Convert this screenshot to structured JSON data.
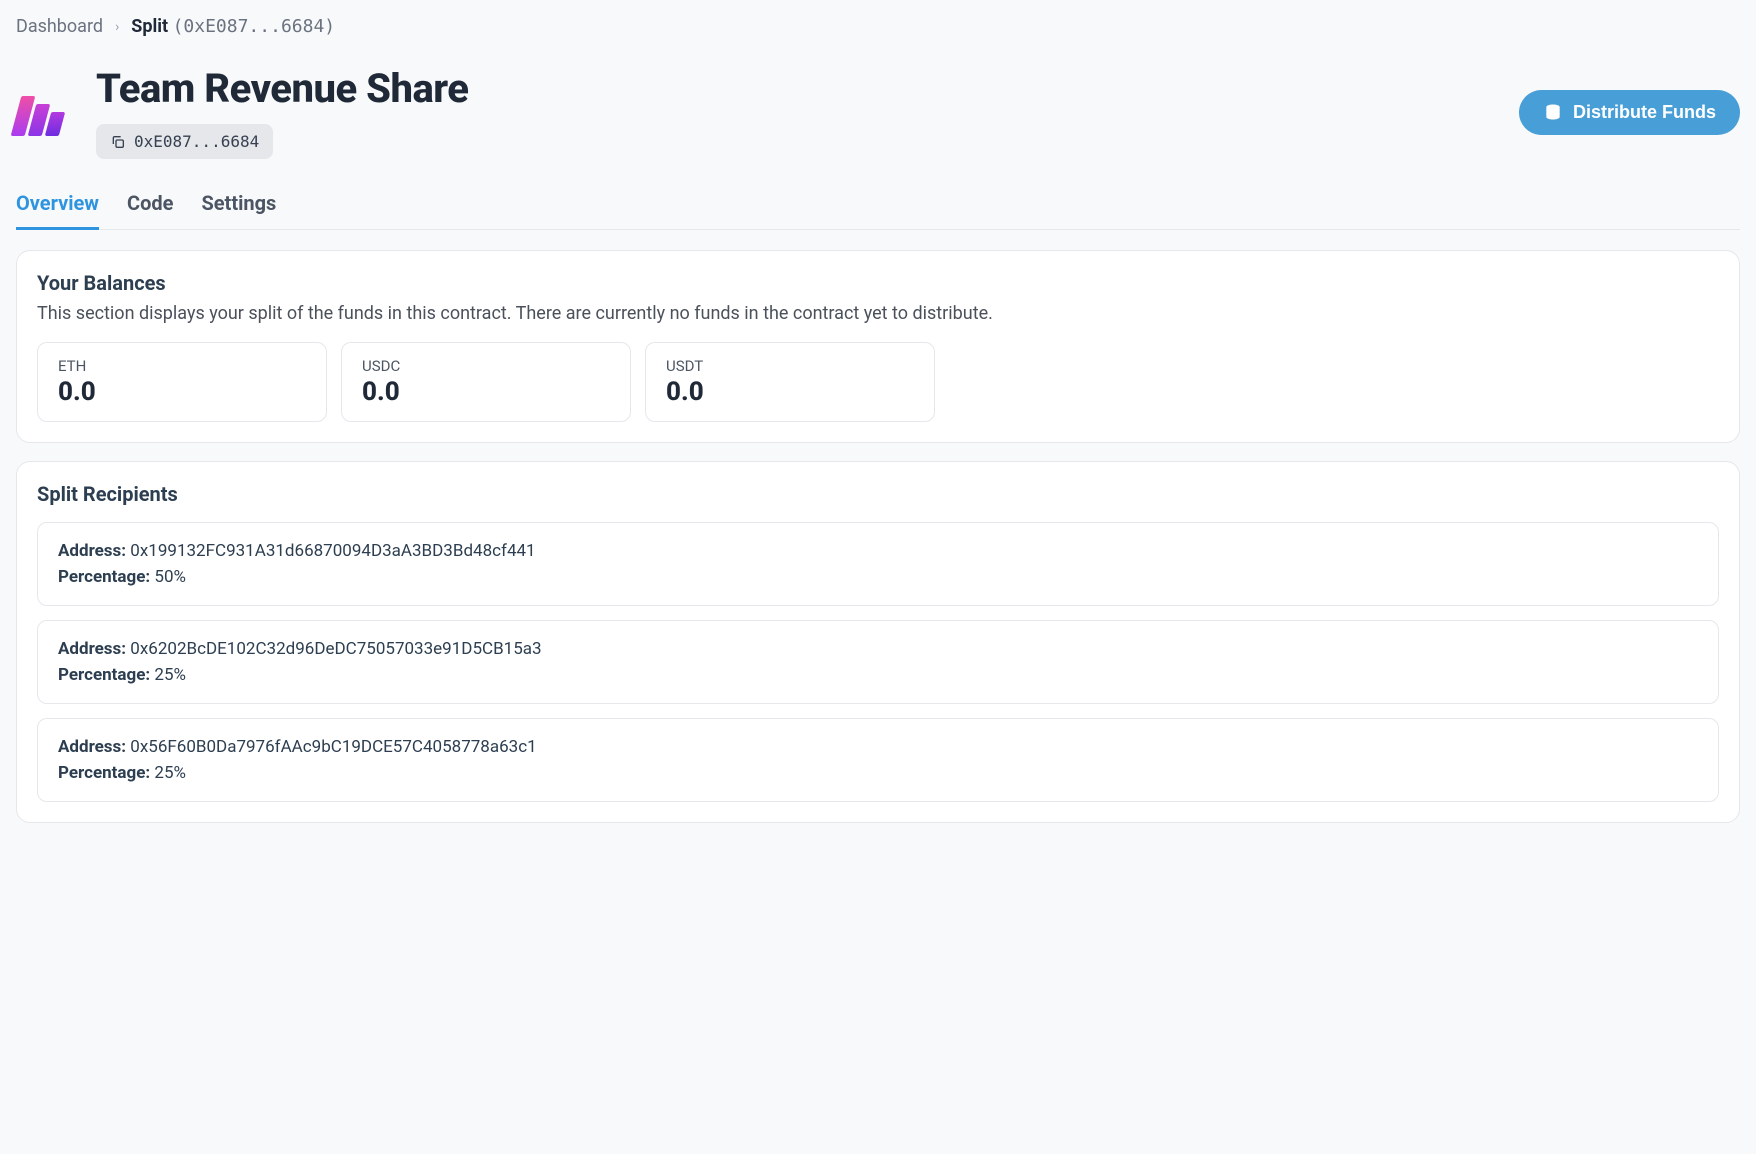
{
  "breadcrumb": {
    "root": "Dashboard",
    "current": "Split",
    "current_hash": "(0xE087...6684)"
  },
  "header": {
    "title": "Team Revenue Share",
    "address_chip": "0xE087...6684",
    "distribute_label": "Distribute Funds"
  },
  "tabs": [
    {
      "label": "Overview",
      "active": true
    },
    {
      "label": "Code",
      "active": false
    },
    {
      "label": "Settings",
      "active": false
    }
  ],
  "balances_card": {
    "title": "Your Balances",
    "subtitle": "This section displays your split of the funds in this contract. There are currently no funds in the contract yet to distribute.",
    "balances": [
      {
        "label": "ETH",
        "value": "0.0"
      },
      {
        "label": "USDC",
        "value": "0.0"
      },
      {
        "label": "USDT",
        "value": "0.0"
      }
    ]
  },
  "recipients_card": {
    "title": "Split Recipients",
    "address_label": "Address:",
    "percentage_label": "Percentage:",
    "recipients": [
      {
        "address": "0x199132FC931A31d66870094D3aA3BD3Bd48cf441",
        "percentage": "50%"
      },
      {
        "address": "0x6202BcDE102C32d96DeDC75057033e91D5CB15a3",
        "percentage": "25%"
      },
      {
        "address": "0x56F60B0Da7976fAAc9bC19DCE57C4058778a63c1",
        "percentage": "25%"
      }
    ]
  }
}
